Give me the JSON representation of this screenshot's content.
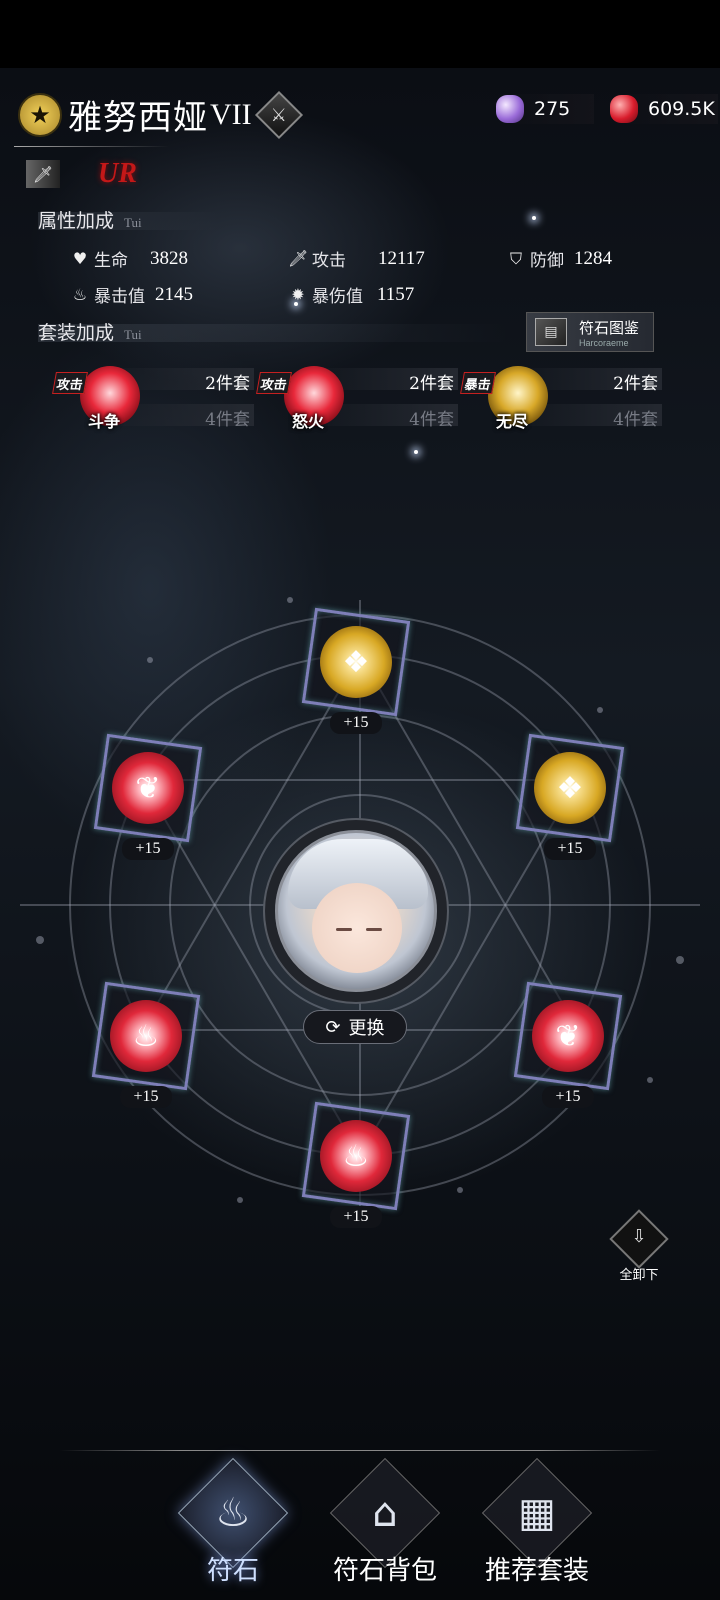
{
  "character": {
    "name": "雅努西娅",
    "rank": "VII",
    "rarity": "UR"
  },
  "currency": [
    {
      "icon": "purple-crystal-icon",
      "value": "275"
    },
    {
      "icon": "red-crystal-icon",
      "value": "609.5K"
    }
  ],
  "attributes": {
    "title": "属性加成",
    "subtitle": "Tui",
    "stats": [
      {
        "icon": "heart-icon",
        "label": "生命",
        "value": "3828"
      },
      {
        "icon": "sword-icon",
        "label": "攻击",
        "value": "12117"
      },
      {
        "icon": "shield-icon",
        "label": "防御",
        "value": "1284"
      },
      {
        "icon": "flame-icon",
        "label": "暴击值",
        "value": "2145"
      },
      {
        "icon": "crit-damage-icon",
        "label": "暴伤值",
        "value": "1157"
      }
    ]
  },
  "sets": {
    "title": "套装加成",
    "subtitle": "Tui",
    "codex": {
      "title": "符石图鉴",
      "subtitle": "Harcoraeme"
    },
    "items": [
      {
        "tag": "攻击",
        "name": "斗争",
        "two_piece": "2件套",
        "four_piece": "4件套",
        "color": "red",
        "accent": "#e8283a"
      },
      {
        "tag": "攻击",
        "name": "怒火",
        "two_piece": "2件套",
        "four_piece": "4件套",
        "color": "red",
        "accent": "#e8283a"
      },
      {
        "tag": "暴击",
        "name": "无尽",
        "two_piece": "2件套",
        "four_piece": "4件套",
        "color": "gold",
        "accent": "#d8a828"
      }
    ]
  },
  "slots": [
    {
      "position": "top",
      "type": "gold",
      "level": "+15"
    },
    {
      "position": "upper-left",
      "type": "red-tree",
      "level": "+15"
    },
    {
      "position": "upper-right",
      "type": "gold",
      "level": "+15"
    },
    {
      "position": "lower-left",
      "type": "red-flame",
      "level": "+15"
    },
    {
      "position": "lower-right",
      "type": "red-tree",
      "level": "+15"
    },
    {
      "position": "bottom",
      "type": "red-flame",
      "level": "+15"
    }
  ],
  "swap_button": {
    "label": "更换"
  },
  "unequip_button": {
    "label": "全卸下"
  },
  "bottom_nav": [
    {
      "label": "符石",
      "icon": "runestone-icon",
      "active": true
    },
    {
      "label": "符石背包",
      "icon": "backpack-icon",
      "active": false
    },
    {
      "label": "推荐套装",
      "icon": "cards-icon",
      "active": false
    }
  ]
}
